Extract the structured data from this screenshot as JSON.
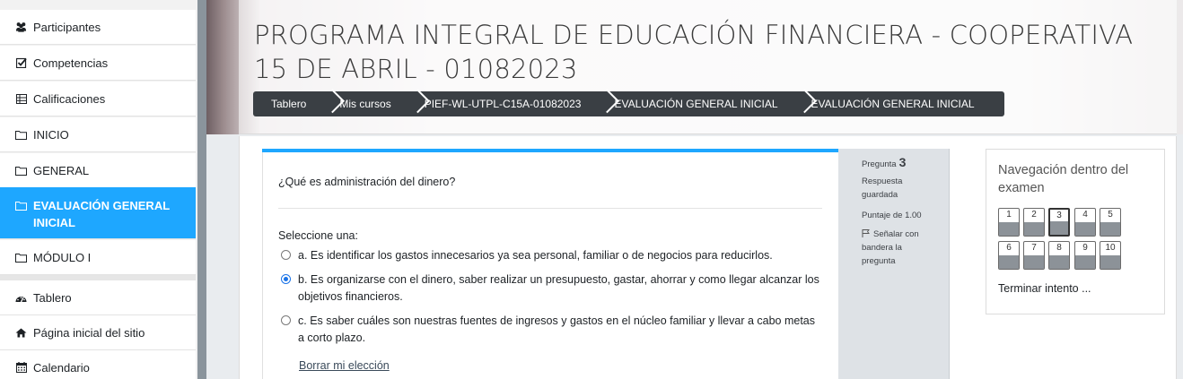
{
  "sidebar": {
    "items": [
      {
        "label": "Participantes",
        "icon": "users-icon"
      },
      {
        "label": "Competencias",
        "icon": "checkbox-icon"
      },
      {
        "label": "Calificaciones",
        "icon": "table-icon"
      },
      {
        "label": "INICIO",
        "icon": "folder-icon"
      },
      {
        "label": "GENERAL",
        "icon": "folder-icon"
      },
      {
        "label": "EVALUACIÓN GENERAL INICIAL",
        "icon": "folder-icon"
      },
      {
        "label": "MÓDULO I",
        "icon": "folder-icon"
      },
      {
        "label": "Tablero",
        "icon": "dashboard-icon"
      },
      {
        "label": "Página inicial del sitio",
        "icon": "home-icon"
      },
      {
        "label": "Calendario",
        "icon": "calendar-icon"
      }
    ]
  },
  "header": {
    "title": "PROGRAMA INTEGRAL DE EDUCACIÓN FINANCIERA - COOPERATIVA 15 DE ABRIL - 01082023",
    "breadcrumb": [
      "Tablero",
      "Mis cursos",
      "PIEF-WL-UTPL-C15A-01082023",
      "EVALUACIÓN GENERAL INICIAL",
      "EVALUACIÓN GENERAL INICIAL"
    ]
  },
  "question": {
    "text": "¿Qué es administración del dinero?",
    "prompt": "Seleccione una:",
    "options": [
      {
        "label": "a. Es identificar los gastos innecesarios ya sea personal, familiar o de negocios para reducirlos.",
        "checked": false
      },
      {
        "label": "b. Es organizarse con el dinero, saber realizar un presupuesto, gastar, ahorrar y como llegar alcanzar los objetivos financieros.",
        "checked": true
      },
      {
        "label": "c. Es saber cuáles son nuestras fuentes de ingresos y gastos en el núcleo familiar y llevar a cabo metas a corto plazo.",
        "checked": false
      }
    ],
    "clear_label": "Borrar mi elección"
  },
  "info": {
    "pregunta_label": "Pregunta",
    "number": "3",
    "status": "Respuesta guardada",
    "score": "Puntaje de 1.00",
    "flag_label": "Señalar con bandera la pregunta"
  },
  "navigation": {
    "title": "Navegación dentro del examen",
    "questions": [
      "1",
      "2",
      "3",
      "4",
      "5",
      "6",
      "7",
      "8",
      "9",
      "10"
    ],
    "current": "3",
    "finish_label": "Terminar intento ..."
  }
}
